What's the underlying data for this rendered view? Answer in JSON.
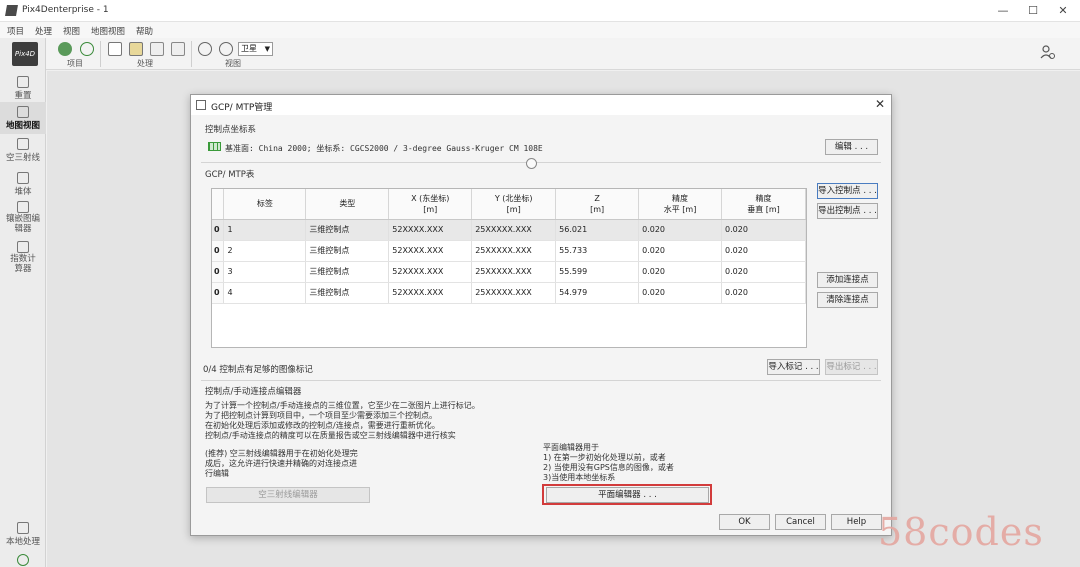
{
  "window": {
    "title": "Pix4Denterprise - 1",
    "controls": [
      "—",
      "☐",
      "✕"
    ]
  },
  "menubar": [
    "项目",
    "处理",
    "视图",
    "地图视图",
    "帮助"
  ],
  "toolbar": {
    "groups": [
      {
        "label": "项目"
      },
      {
        "label": "处理"
      },
      {
        "label": "视图"
      }
    ],
    "basemap": "卫星"
  },
  "sidebar": {
    "logo": "Pix4D",
    "items": [
      {
        "label": "重置",
        "active": false
      },
      {
        "label": "地图视图",
        "active": true
      },
      {
        "label": "空三射线",
        "active": false
      },
      {
        "label": "堆体",
        "active": false
      },
      {
        "label": "镶嵌图编辑器",
        "active": false
      },
      {
        "label": "指数计算器",
        "active": false
      },
      {
        "label": "本地处理",
        "active": false
      }
    ]
  },
  "dialog": {
    "title": "GCP/ MTP管理",
    "close": "✕",
    "coord_section": {
      "title": "控制点坐标系",
      "text": "基准面: China 2000; 坐标系: CGCS2000 / 3-degree Gauss-Kruger CM 108E",
      "edit_button": "编辑 . . ."
    },
    "table_section": {
      "title": "GCP/ MTP表",
      "headers": [
        "标签",
        "类型",
        "X (东坐标)\n[m]",
        "Y (北坐标)\n[m]",
        "Z\n[m]",
        "精度\n水平 [m]",
        "精度\n垂直 [m]"
      ],
      "rows": [
        {
          "flag": "0",
          "label": "1",
          "type": "三维控制点",
          "x": "52XXXX.XXX",
          "y": "25XXXXX.XXX",
          "z": "56.021",
          "h": "0.020",
          "v": "0.020"
        },
        {
          "flag": "0",
          "label": "2",
          "type": "三维控制点",
          "x": "52XXXX.XXX",
          "y": "25XXXXX.XXX",
          "z": "55.733",
          "h": "0.020",
          "v": "0.020"
        },
        {
          "flag": "0",
          "label": "3",
          "type": "三维控制点",
          "x": "52XXXX.XXX",
          "y": "25XXXXX.XXX",
          "z": "55.599",
          "h": "0.020",
          "v": "0.020"
        },
        {
          "flag": "0",
          "label": "4",
          "type": "三维控制点",
          "x": "52XXXX.XXX",
          "y": "25XXXXX.XXX",
          "z": "54.979",
          "h": "0.020",
          "v": "0.020"
        }
      ],
      "buttons": {
        "import_gcp": "导入控制点 . . .",
        "export_gcp": "导出控制点 . . .",
        "add_tie": "添加连接点",
        "clear_tie": "清除连接点"
      },
      "status": "0/4 控制点有足够的图像标记",
      "import_marks": "导入标记 . . .",
      "export_marks": "导出标记 . . ."
    },
    "editor_section": {
      "title": "控制点/手动连接点编辑器",
      "desc_lines": [
        "为了计算一个控制点/手动连接点的三维位置，它至少在二张图片上进行标记。",
        "为了把控制点计算到项目中，一个项目至少需要添加三个控制点。",
        "在初始化处理后添加或修改的控制点/连接点，需要进行重新优化。",
        "控制点/手动连接点的精度可以在质量报告或空三射线编辑器中进行核实"
      ],
      "ray_desc_lines": [
        "(推荐) 空三射线编辑器用于在初始化处理完",
        "成后，这允许进行快速并精确的对连接点进",
        "行编辑"
      ],
      "ray_button": "空三射线编辑器",
      "planar_desc_lines": [
        "平面编辑器用于",
        "1) 在第一步初始化处理以前，或者",
        "2) 当使用没有GPS信息的图像，或者",
        "3)当使用本地坐标系"
      ],
      "planar_button": "平面编辑器 . . ."
    },
    "footer": {
      "ok": "OK",
      "cancel": "Cancel",
      "help": "Help"
    }
  },
  "watermark": "58codes"
}
